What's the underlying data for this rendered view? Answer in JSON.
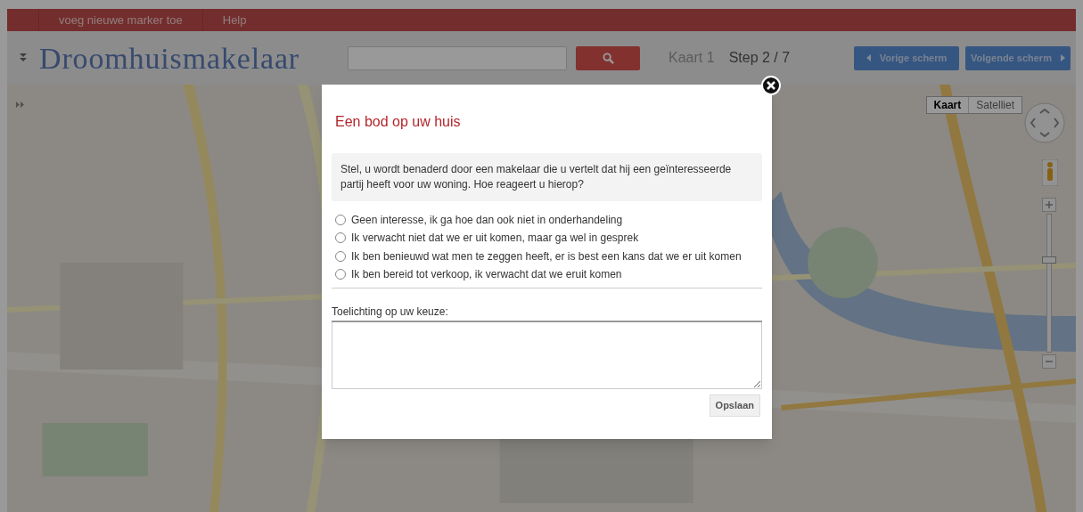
{
  "menu_bar": {
    "items": [
      "voeg nieuwe marker toe",
      "Help"
    ]
  },
  "header": {
    "logo": "Droomhuismakelaar",
    "map_label": "Kaart 1",
    "step": "Step 2 / 7",
    "buttons": [
      {
        "label": "Vorige scherm",
        "kind": "prev"
      },
      {
        "label": "Volgende scherm",
        "kind": "next"
      }
    ]
  },
  "map": {
    "map_types": [
      {
        "label": "Kaart",
        "selected": true
      },
      {
        "label": "Satelliet",
        "selected": false
      }
    ],
    "zoom": {
      "level": 0.67
    }
  },
  "dialog": {
    "title": "Een bod op uw huis",
    "question": "Stel, u wordt benaderd door een makelaar die u vertelt dat hij een geïnteresseerde partij heeft voor uw woning. Hoe reageert u hierop?",
    "options": [
      {
        "label": "Geen interesse, ik ga hoe dan ook niet in onderhandeling",
        "selected": false
      },
      {
        "label": "Ik verwacht niet dat we er uit komen, maar ga wel in gesprek",
        "selected": false
      },
      {
        "label": "Ik ben benieuwd wat men te zeggen heeft, er is best een kans dat we er uit komen",
        "selected": false
      },
      {
        "label": "Ik ben bereid tot verkoop, ik verwacht dat we eruit komen",
        "selected": false
      }
    ],
    "comment_label": "Toelichting op uw keuze:",
    "save_button": "Opslaan"
  }
}
